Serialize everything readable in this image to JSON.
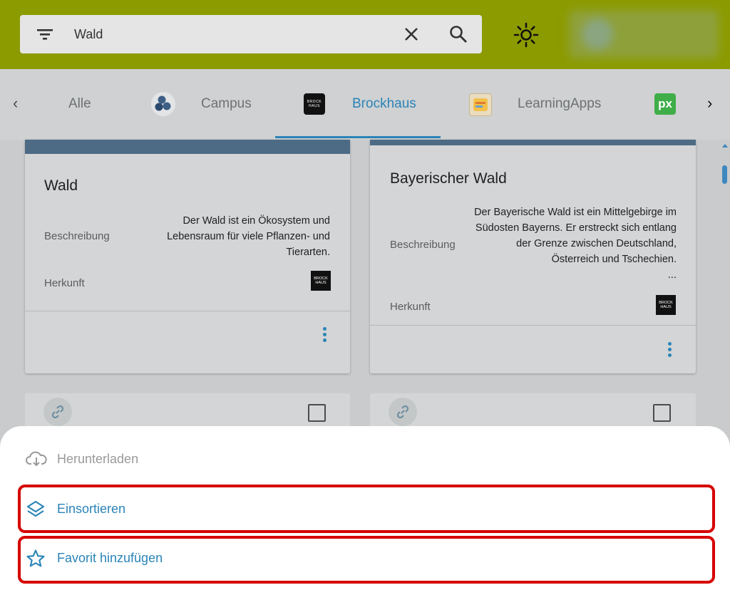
{
  "search": {
    "query": "Wald"
  },
  "tabs": {
    "items": [
      {
        "label": "Alle"
      },
      {
        "label": "Campus"
      },
      {
        "label": "Brockhaus",
        "active": true
      },
      {
        "label": "LearningApps"
      }
    ],
    "px_logo": "px",
    "brockhaus_logo": [
      "BROCK",
      "HAUS"
    ]
  },
  "cards": [
    {
      "title": "Wald",
      "description_label": "Beschreibung",
      "description": "Der Wald ist ein Ökosystem und Lebensraum für viele Pflanzen- und Tierarten.",
      "origin_label": "Herkunft"
    },
    {
      "title": "Bayerischer Wald",
      "description_label": "Beschreibung",
      "description": "Der Bayerische Wald ist ein Mittelgebirge im Südosten Bayerns. Er erstreckt sich entlang der Grenze zwischen Deutschland, Österreich und Tschechien.",
      "ellipsis": "...",
      "origin_label": "Herkunft"
    }
  ],
  "sheet": {
    "download": "Herunterladen",
    "sort_in": "Einsortieren",
    "favorite": "Favorit hinzufügen"
  },
  "colors": {
    "topbar": "#8c9b00",
    "accent": "#2b84b8",
    "highlight": "#d60000"
  }
}
